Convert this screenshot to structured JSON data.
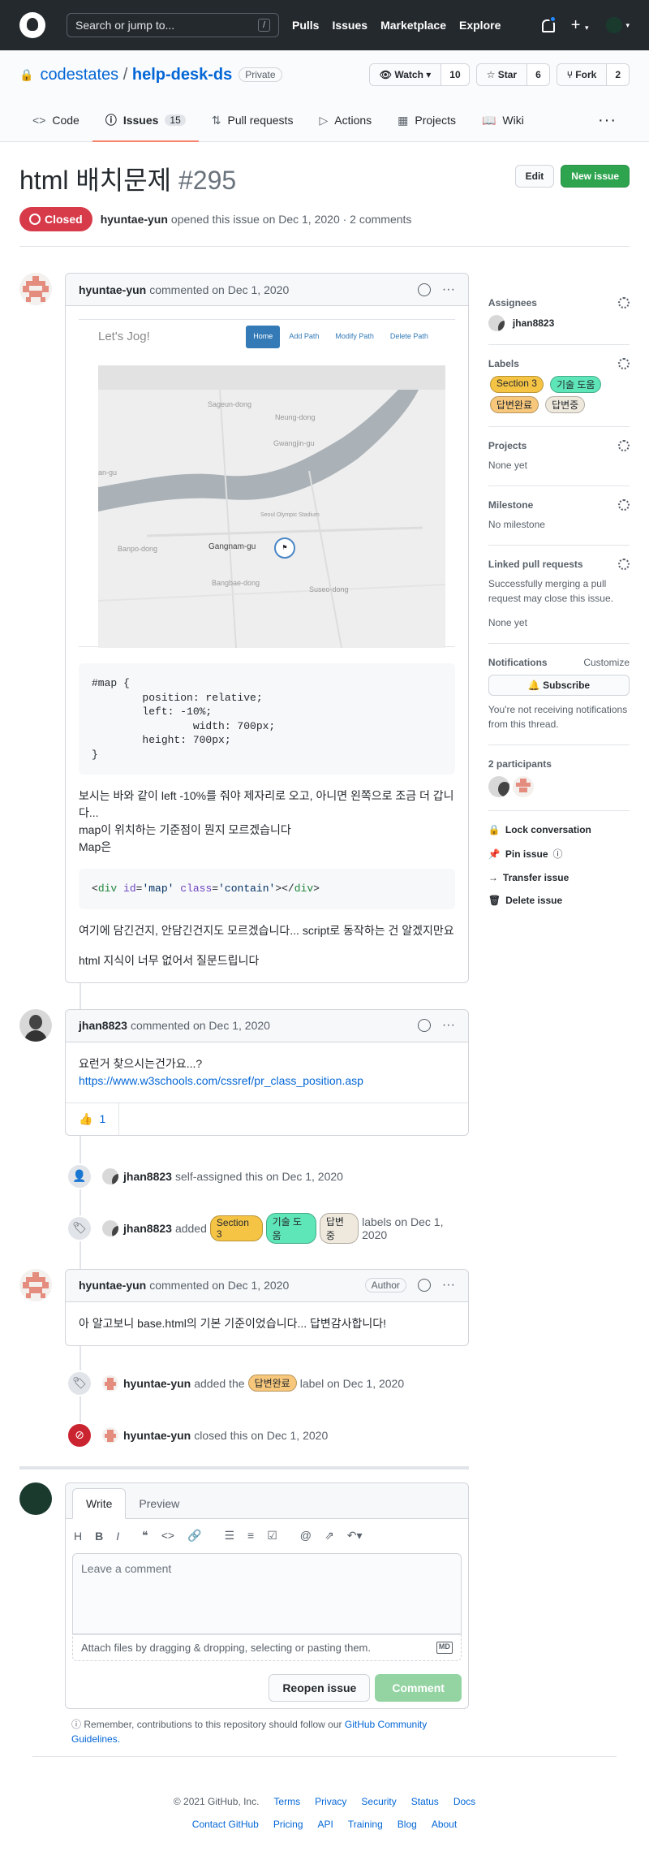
{
  "header": {
    "search_placeholder": "Search or jump to...",
    "search_key": "/",
    "nav": [
      "Pulls",
      "Issues",
      "Marketplace",
      "Explore"
    ]
  },
  "repo": {
    "owner": "codestates",
    "name": "help-desk-ds",
    "visibility": "Private",
    "watch_label": "Watch",
    "watch_count": "10",
    "star_label": "Star",
    "star_count": "6",
    "fork_label": "Fork",
    "fork_count": "2"
  },
  "tabs": [
    {
      "label": "Code"
    },
    {
      "label": "Issues",
      "count": "15"
    },
    {
      "label": "Pull requests"
    },
    {
      "label": "Actions"
    },
    {
      "label": "Projects"
    },
    {
      "label": "Wiki"
    }
  ],
  "issue": {
    "title": "html 배치문제",
    "number": "#295",
    "edit_label": "Edit",
    "new_issue_label": "New issue",
    "state": "Closed",
    "author": "hyuntae-yun",
    "meta": "opened this issue on Dec 1, 2020 · 2 comments"
  },
  "comment1": {
    "author": "hyuntae-yun",
    "meta": "commented on Dec 1, 2020",
    "shot_logo": "Let's Jog!",
    "shot_nav": [
      "Home",
      "Add Path",
      "Modify Path",
      "Delete Path"
    ],
    "map_labels": [
      "Sageun-dong",
      "Neung-dong",
      "Gwangjin-gu",
      "an-gu",
      "Seoul Olympic Stadium",
      "Gangnam-gu",
      "Banpo-dong",
      "Bangbae-dong",
      "Suseo-dong"
    ],
    "code1": "#map {\n        position: relative;\n        left: -10%;\n                width: 700px;\n        height: 700px;\n}",
    "p1": "보시는 바와 같이 left -10%를 줘야 제자리로 오고, 아니면 왼쪽으로 조금 더 갑니다...",
    "p2": "map이 위치하는 기준점이 뭔지 모르겠습니다",
    "p3": "Map은",
    "code2_tag": "div",
    "code2_attr1": "id",
    "code2_val1": "'map'",
    "code2_attr2": "class",
    "code2_val2": "'contain'",
    "p4": "여기에 담긴건지, 안담긴건지도 모르겠습니다... script로 동작하는 건 알겠지만요",
    "p5": "html 지식이 너무 없어서 질문드립니다"
  },
  "comment2": {
    "author": "jhan8823",
    "meta": "commented on Dec 1, 2020",
    "text": "요런거 찾으시는건가요...?",
    "link": "https://www.w3schools.com/cssref/pr_class_position.asp",
    "reaction_emoji": "👍",
    "reaction_count": "1"
  },
  "events": {
    "assign_user": "jhan8823",
    "assign_text": "self-assigned this on Dec 1, 2020",
    "labels_user": "jhan8823",
    "labels_added": "added",
    "labels_suffix": "labels on Dec 1, 2020",
    "label_user": "hyuntae-yun",
    "label_added": "added the",
    "label_suffix": "label on Dec 1, 2020",
    "close_user": "hyuntae-yun",
    "close_text": "closed this on Dec 1, 2020"
  },
  "comment3": {
    "author": "hyuntae-yun",
    "meta": "commented on Dec 1, 2020",
    "badge": "Author",
    "text": "아 알고보니 base.html의 기본 기준이었습니다... 답변감사합니다!"
  },
  "labels": {
    "section3": "Section 3",
    "tech": "기술 도움",
    "done": "답변완료",
    "pending": "답변중"
  },
  "new_comment": {
    "write_tab": "Write",
    "preview_tab": "Preview",
    "placeholder": "Leave a comment",
    "attach": "Attach files by dragging & dropping, selecting or pasting them.",
    "md": "MD",
    "reopen": "Reopen issue",
    "submit": "Comment",
    "remember": "Remember, contributions to this repository should follow our",
    "guidelines": "GitHub Community Guidelines."
  },
  "sidebar": {
    "assignees_h": "Assignees",
    "assignee": "jhan8823",
    "labels_h": "Labels",
    "projects_h": "Projects",
    "projects_v": "None yet",
    "milestone_h": "Milestone",
    "milestone_v": "No milestone",
    "linked_h": "Linked pull requests",
    "linked_text": "Successfully merging a pull request may close this issue.",
    "linked_v": "None yet",
    "notif_h": "Notifications",
    "customize": "Customize",
    "subscribe": "Subscribe",
    "notif_text": "You're not receiving notifications from this thread.",
    "participants_h": "2 participants",
    "lock": "Lock conversation",
    "pin": "Pin issue",
    "transfer": "Transfer issue",
    "delete": "Delete issue"
  },
  "footer": {
    "copyright": "© 2021 GitHub, Inc.",
    "row1": [
      "Terms",
      "Privacy",
      "Security",
      "Status",
      "Docs"
    ],
    "row2": [
      "Contact GitHub",
      "Pricing",
      "API",
      "Training",
      "Blog",
      "About"
    ]
  }
}
